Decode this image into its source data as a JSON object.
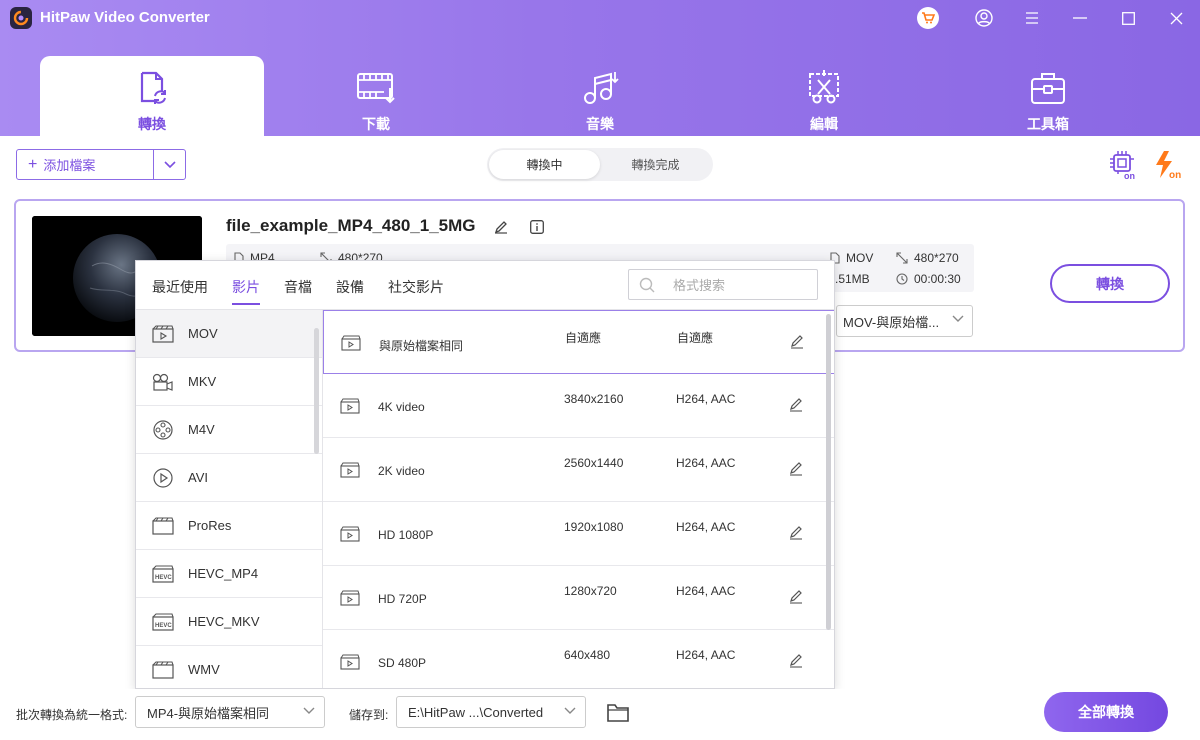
{
  "app": {
    "title": "HitPaw Video Converter"
  },
  "window_controls": [
    "cart-icon",
    "account-icon",
    "menu-icon",
    "minimize-icon",
    "maximize-icon",
    "close-icon"
  ],
  "nav": {
    "tabs": [
      {
        "label": "轉換",
        "icon": "convert-doc-icon",
        "active": true
      },
      {
        "label": "下載",
        "icon": "download-film-icon",
        "active": false
      },
      {
        "label": "音樂",
        "icon": "music-note-icon",
        "active": false
      },
      {
        "label": "編輯",
        "icon": "cut-edit-icon",
        "active": false
      },
      {
        "label": "工具箱",
        "icon": "toolbox-icon",
        "active": false
      }
    ]
  },
  "toolbar": {
    "add_file_label": "添加檔案",
    "segments": [
      {
        "label": "轉換中",
        "active": true
      },
      {
        "label": "轉換完成",
        "active": false
      }
    ],
    "hardware_accel_icon": "hardware-accel-on-icon",
    "lossless_icon": "lightning-on-icon"
  },
  "file": {
    "name": "file_example_MP4_480_1_5MG",
    "source_format": "MP4",
    "source_resolution": "480*270",
    "target_format": "MOV",
    "target_resolution": "480*270",
    "target_size": ".51MB",
    "target_duration": "00:00:30",
    "convert_label": "轉換",
    "format_select_value": "MOV-與原始檔..."
  },
  "format_popup": {
    "tabs": [
      {
        "label": "最近使用",
        "active": false
      },
      {
        "label": "影片",
        "active": true
      },
      {
        "label": "音檔",
        "active": false
      },
      {
        "label": "設備",
        "active": false
      },
      {
        "label": "社交影片",
        "active": false
      }
    ],
    "search_placeholder": "格式搜索",
    "formats": [
      {
        "label": "MOV",
        "icon": "clapper-icon",
        "selected": true
      },
      {
        "label": "MKV",
        "icon": "camera-icon",
        "selected": false
      },
      {
        "label": "M4V",
        "icon": "film-reel-icon",
        "selected": false
      },
      {
        "label": "AVI",
        "icon": "play-circle-icon",
        "selected": false
      },
      {
        "label": "ProRes",
        "icon": "clapper-icon",
        "selected": false
      },
      {
        "label": "HEVC_MP4",
        "icon": "hevc-icon",
        "selected": false
      },
      {
        "label": "HEVC_MKV",
        "icon": "hevc-icon",
        "selected": false
      },
      {
        "label": "WMV",
        "icon": "clapper-icon",
        "selected": false
      }
    ],
    "presets": [
      {
        "name": "與原始檔案相同",
        "resolution": "自適應",
        "codec": "自適應",
        "selected": true
      },
      {
        "name": "4K video",
        "resolution": "3840x2160",
        "codec": "H264, AAC",
        "selected": false
      },
      {
        "name": "2K video",
        "resolution": "2560x1440",
        "codec": "H264, AAC",
        "selected": false
      },
      {
        "name": "HD 1080P",
        "resolution": "1920x1080",
        "codec": "H264, AAC",
        "selected": false
      },
      {
        "name": "HD 720P",
        "resolution": "1280x720",
        "codec": "H264, AAC",
        "selected": false
      },
      {
        "name": "SD 480P",
        "resolution": "640x480",
        "codec": "H264, AAC",
        "selected": false
      }
    ]
  },
  "bottom": {
    "batch_label": "批次轉換為統一格式:",
    "batch_value": "MP4-與原始檔案相同",
    "save_label": "儲存到:",
    "save_value": "E:\\HitPaw ...\\Converted",
    "convert_all_label": "全部轉換"
  },
  "colors": {
    "accent": "#7b4fe0",
    "header_start": "#a98bf2",
    "header_end": "#8a67e4"
  }
}
